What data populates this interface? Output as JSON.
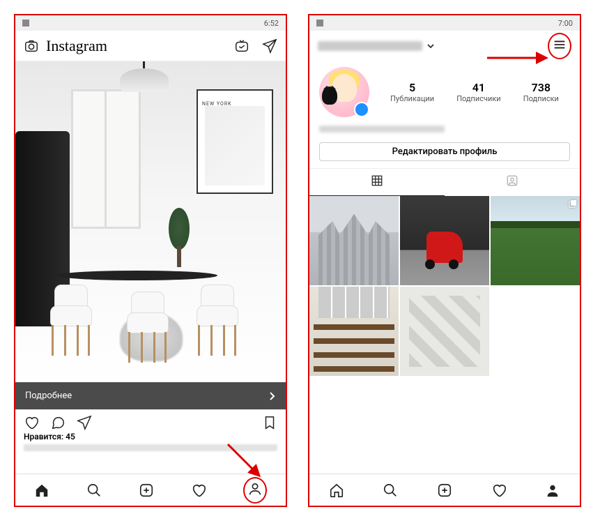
{
  "colors": {
    "highlight": "#d00000",
    "accent": "#1e90ff"
  },
  "left_screen": {
    "status_time": "6:52",
    "app_name": "Instagram",
    "feed": {
      "poster_text": "NEW YORK",
      "banner_label": "Подробнее",
      "likes_text": "Нравится: 45"
    },
    "nav_items": [
      "home",
      "search",
      "add",
      "activity",
      "profile"
    ]
  },
  "right_screen": {
    "status_time": "7:00",
    "profile": {
      "stats": [
        {
          "count": "5",
          "label": "Публикации"
        },
        {
          "count": "41",
          "label": "Подписчики"
        },
        {
          "count": "738",
          "label": "Подписки"
        }
      ],
      "edit_button": "Редактировать профиль",
      "tabs": [
        "grid",
        "tagged"
      ],
      "grid_count": 5
    },
    "nav_items": [
      "home",
      "search",
      "add",
      "activity",
      "profile"
    ]
  }
}
